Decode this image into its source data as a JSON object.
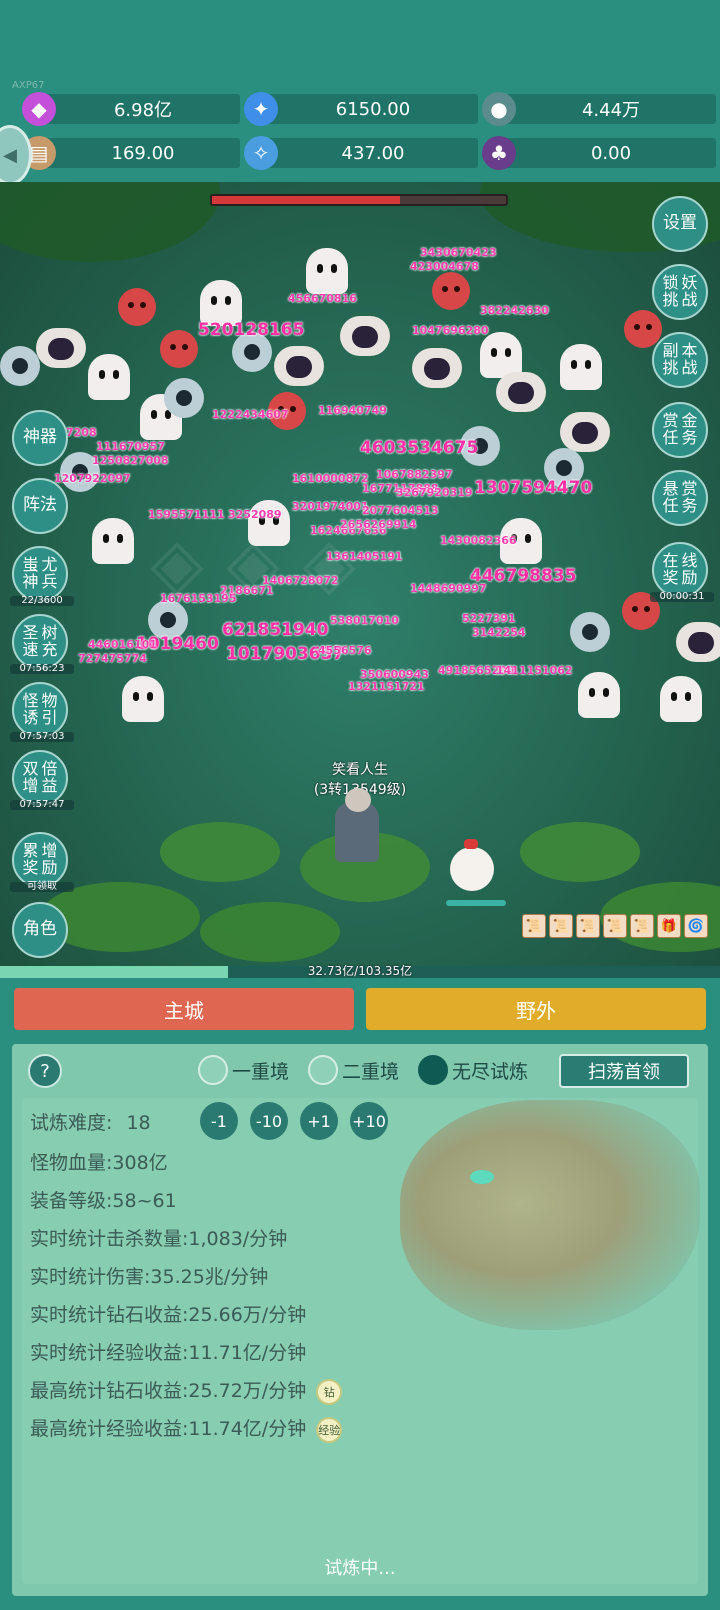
{
  "app_code": "AXP67",
  "resources": [
    {
      "icon": "purple-diamond-icon",
      "value": "6.98亿"
    },
    {
      "icon": "blue-crystal-icon",
      "value": "6150.00"
    },
    {
      "icon": "globe-icon",
      "value": "4.44万"
    },
    {
      "icon": "scroll-icon",
      "value": "169.00"
    },
    {
      "icon": "blue-shard-icon",
      "value": "437.00"
    },
    {
      "icon": "purple-pouch-icon",
      "value": "0.00"
    }
  ],
  "left_buttons": [
    {
      "label": "神器",
      "timer": ""
    },
    {
      "label": "阵法",
      "timer": ""
    },
    {
      "label": "蚩尤神兵",
      "timer": "22/3600"
    },
    {
      "label": "圣树速充",
      "timer": "07:56:23"
    },
    {
      "label": "怪物诱引",
      "timer": "07:57:03"
    },
    {
      "label": "双倍增益",
      "timer": "07:57:47"
    },
    {
      "label": "累增奖励",
      "timer": "可领取"
    },
    {
      "label": "角色",
      "timer": ""
    }
  ],
  "right_buttons": [
    {
      "label": "设置",
      "timer": ""
    },
    {
      "label": "锁妖挑战",
      "timer": ""
    },
    {
      "label": "副本挑战",
      "timer": ""
    },
    {
      "label": "赏金任务",
      "timer": ""
    },
    {
      "label": "悬赏任务",
      "timer": ""
    },
    {
      "label": "在线奖励",
      "timer": "00:00:31"
    }
  ],
  "boss_hp_fraction": 0.64,
  "damage_numbers": {
    "big": [
      "520128165",
      "4603534675",
      "1307594470",
      "446798835",
      "621851940",
      "1017903637",
      "1019460"
    ],
    "small": [
      "3430670423",
      "423004678",
      "456670816",
      "382242630",
      "1047696280",
      "1222434607",
      "116940749",
      "1067882397",
      "1677117888",
      "1610000872",
      "3201974001",
      "2077604513",
      "3267920319",
      "1624667636",
      "2656269914",
      "1430082366",
      "1361405191",
      "1595571111",
      "1406728072",
      "2186671",
      "1448690997",
      "5227391",
      "3142254",
      "1676153195",
      "446016101",
      "727475774",
      "538017010",
      "4556576",
      "350600943",
      "1321151721",
      "4918565200",
      "1411151062",
      "1207922097",
      "1250827008",
      "111670957",
      "3252089",
      "7208"
    ]
  },
  "player": {
    "name": "笑看人生",
    "level": "(3转13549级)"
  },
  "item_slots": [
    "📜",
    "📜",
    "📜",
    "📜",
    "📜",
    "🎁",
    "🌀"
  ],
  "exp": {
    "text": "32.73亿/103.35亿",
    "fraction": 0.3167
  },
  "tabs": {
    "city": "主城",
    "field": "野外"
  },
  "help_label": "?",
  "modes": [
    {
      "label": "一重境",
      "selected": false
    },
    {
      "label": "二重境",
      "selected": false
    },
    {
      "label": "无尽试炼",
      "selected": true
    }
  ],
  "sweep_label": "扫荡首领",
  "difficulty": {
    "label": "试炼难度:",
    "value": "18",
    "buttons": [
      "-1",
      "-10",
      "+1",
      "+10"
    ]
  },
  "stats": [
    {
      "label": "怪物血量:",
      "value": "308亿",
      "tag": ""
    },
    {
      "label": "装备等级:",
      "value": "58~61",
      "tag": ""
    },
    {
      "label": "实时统计击杀数量:",
      "value": "1,083/分钟",
      "tag": ""
    },
    {
      "label": "实时统计伤害:",
      "value": "35.25兆/分钟",
      "tag": ""
    },
    {
      "label": "实时统计钻石收益:",
      "value": "25.66万/分钟",
      "tag": ""
    },
    {
      "label": "实时统计经验收益:",
      "value": "11.71亿/分钟",
      "tag": ""
    },
    {
      "label": "最高统计钻石收益:",
      "value": "25.72万/分钟",
      "tag": "钻"
    },
    {
      "label": "最高统计经验收益:",
      "value": "11.74亿/分钟",
      "tag": "经验"
    }
  ],
  "status_text": "试炼中..."
}
